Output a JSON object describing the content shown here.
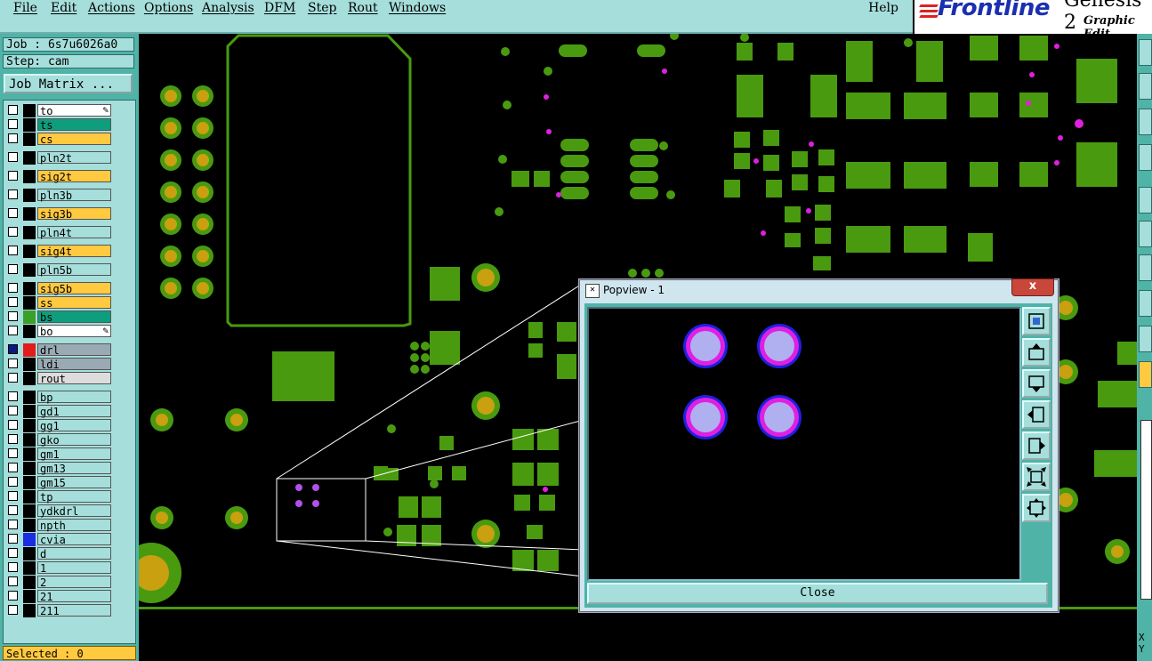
{
  "menu": {
    "items": [
      "File",
      "Edit",
      "Actions",
      "Options",
      "Analysis",
      "DFM",
      "Step",
      "Rout",
      "Windows"
    ],
    "help": "Help"
  },
  "logo": {
    "brand": "Frontline",
    "product": "Genesis 2",
    "subtitle": "Graphic Edit"
  },
  "job": {
    "job_label": "Job : 6s7u6026a0",
    "step_label": "Step: cam",
    "matrix_button": "Job Matrix ..."
  },
  "layers": [
    {
      "name": "to",
      "color": "#ffffff",
      "swatch": "#000000",
      "pen": true
    },
    {
      "name": "ts",
      "color": "#0f9e7d",
      "swatch": "#000000"
    },
    {
      "name": "cs",
      "color": "#ffc940",
      "swatch": "#000000"
    },
    {
      "name": "pln2t",
      "color": "#a5dedb",
      "swatch": "#000000"
    },
    {
      "name": "sig2t",
      "color": "#ffc940",
      "swatch": "#000000"
    },
    {
      "name": "pln3b",
      "color": "#a5dedb",
      "swatch": "#000000"
    },
    {
      "name": "sig3b",
      "color": "#ffc940",
      "swatch": "#000000"
    },
    {
      "name": "pln4t",
      "color": "#a5dedb",
      "swatch": "#000000"
    },
    {
      "name": "sig4t",
      "color": "#ffc940",
      "swatch": "#000000"
    },
    {
      "name": "pln5b",
      "color": "#a5dedb",
      "swatch": "#000000"
    },
    {
      "name": "sig5b",
      "color": "#ffc940",
      "swatch": "#000000"
    },
    {
      "name": "ss",
      "color": "#ffc940",
      "swatch": "#000000"
    },
    {
      "name": "bs",
      "color": "#0f9e7d",
      "swatch": "#3aa02a"
    },
    {
      "name": "bo",
      "color": "#ffffff",
      "swatch": "#000000",
      "pen": true
    },
    {
      "name": "drl",
      "color": "#9aaab4",
      "swatch": "#e21b1b",
      "checked": true
    },
    {
      "name": "ldi",
      "color": "#9aaab4",
      "swatch": "#000000"
    },
    {
      "name": "rout",
      "color": "#dcdcdc",
      "swatch": "#000000"
    },
    {
      "name": "bp",
      "color": "#a5dedb",
      "swatch": "#000000"
    },
    {
      "name": "gd1",
      "color": "#a5dedb",
      "swatch": "#000000"
    },
    {
      "name": "gg1",
      "color": "#a5dedb",
      "swatch": "#000000"
    },
    {
      "name": "gko",
      "color": "#a5dedb",
      "swatch": "#000000"
    },
    {
      "name": "gm1",
      "color": "#a5dedb",
      "swatch": "#000000"
    },
    {
      "name": "gm13",
      "color": "#a5dedb",
      "swatch": "#000000"
    },
    {
      "name": "gm15",
      "color": "#a5dedb",
      "swatch": "#000000"
    },
    {
      "name": "tp",
      "color": "#a5dedb",
      "swatch": "#000000"
    },
    {
      "name": "ydkdrl",
      "color": "#a5dedb",
      "swatch": "#000000"
    },
    {
      "name": "npth",
      "color": "#a5dedb",
      "swatch": "#000000"
    },
    {
      "name": "cvia",
      "color": "#a5dedb",
      "swatch": "#1a2de0"
    },
    {
      "name": "d",
      "color": "#a5dedb",
      "swatch": "#000000"
    },
    {
      "name": "1",
      "color": "#a5dedb",
      "swatch": "#000000"
    },
    {
      "name": "2",
      "color": "#a5dedb",
      "swatch": "#000000"
    },
    {
      "name": "21",
      "color": "#a5dedb",
      "swatch": "#000000"
    },
    {
      "name": "211",
      "color": "#a5dedb",
      "swatch": "#000000"
    }
  ],
  "status": {
    "selected": "Selected : 0"
  },
  "popup": {
    "title": "Popview - 1",
    "close_x": "x",
    "close_button": "Close"
  },
  "coords": {
    "x": "X",
    "y": "Y"
  },
  "colors": {
    "pcb_green": "#4a9a10",
    "pad_gold": "#c8a010",
    "via_magenta": "#e020e0",
    "via_blue": "#2020e0",
    "via_core": "#b0b0f0"
  }
}
